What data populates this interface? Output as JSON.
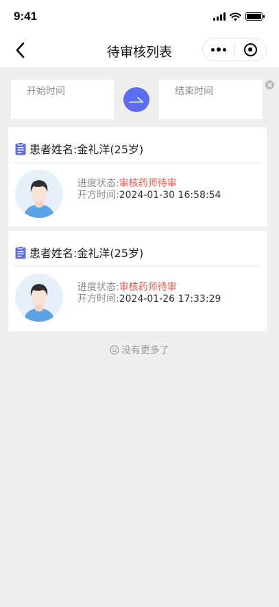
{
  "status_bar": {
    "time": "9:41"
  },
  "nav": {
    "title": "待审核列表"
  },
  "filter": {
    "start_placeholder": "开始时间",
    "end_placeholder": "结束时间"
  },
  "prescriptions": [
    {
      "patient_label": "患者姓名:金礼洋(25岁)",
      "status_label": "进度状态:",
      "status_value": "审核药师待审",
      "time_label": "开方时间:",
      "time_value": "2024-01-30 16:58:54"
    },
    {
      "patient_label": "患者姓名:金礼洋(25岁)",
      "status_label": "进度状态:",
      "status_value": "审核药师待审",
      "time_label": "开方时间:",
      "time_value": "2024-01-26 17:33:29"
    }
  ],
  "footer": {
    "no_more": "没有更多了"
  },
  "colors": {
    "accent": "#5b6cf0",
    "status": "#e05a4a",
    "background": "#efefef"
  },
  "icons": [
    "back-icon",
    "more-icon",
    "target-icon",
    "arrow-right-icon",
    "clear-icon",
    "document-icon",
    "avatar",
    "smile-icon"
  ]
}
